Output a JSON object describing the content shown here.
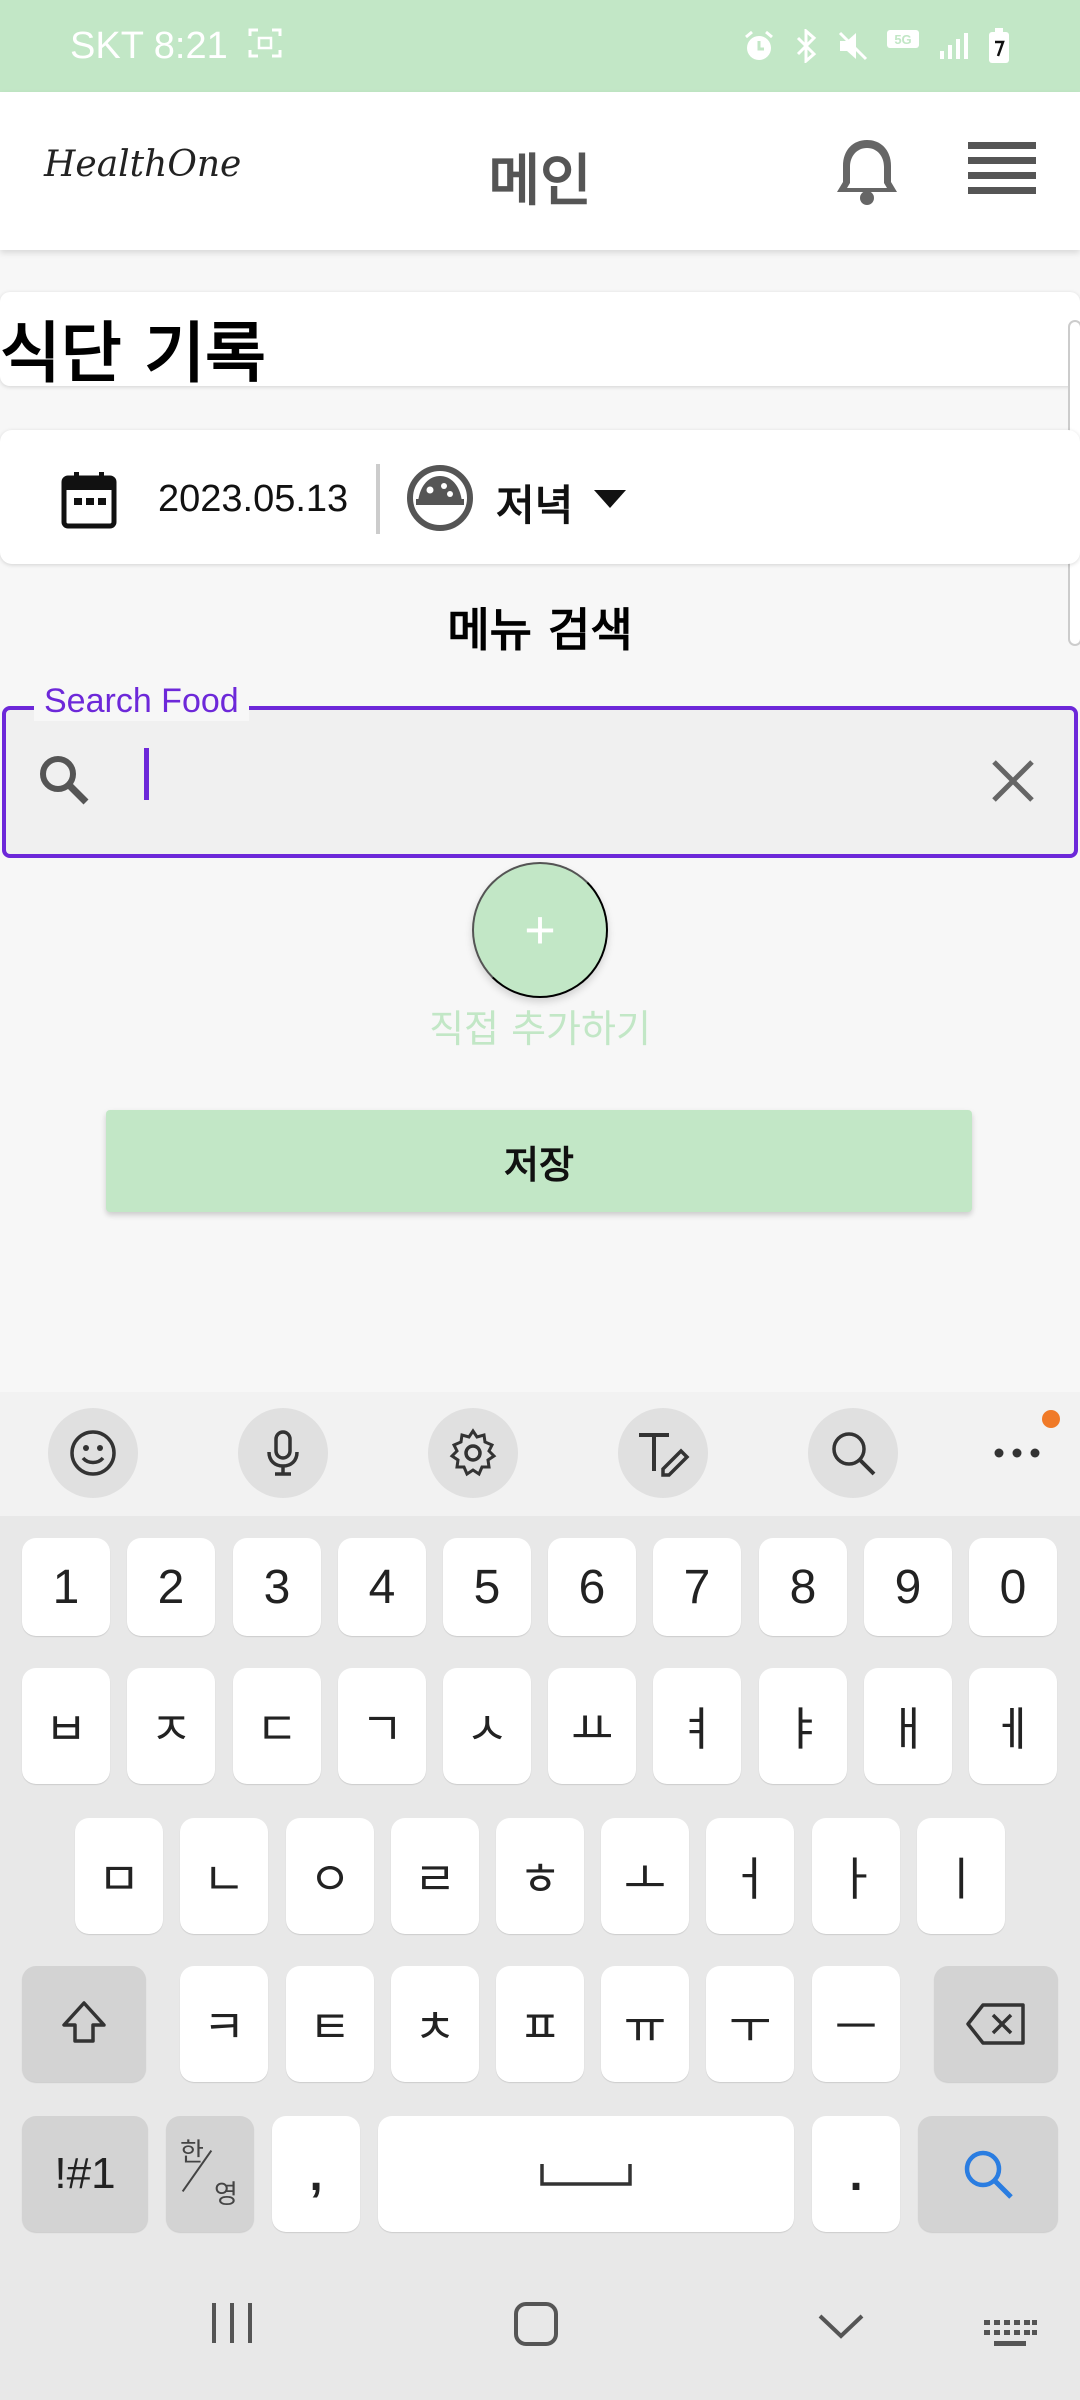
{
  "status_bar": {
    "carrier_time": "SKT 8:21",
    "network": "5G"
  },
  "header": {
    "logo": "HealthOne",
    "title": "메인"
  },
  "page": {
    "title": "식단 기록"
  },
  "date_row": {
    "date": "2023.05.13",
    "meal": "저녁"
  },
  "search": {
    "section_title": "메뉴 검색",
    "label": "Search Food",
    "value": ""
  },
  "add_manual": {
    "icon": "+",
    "label": "직접 추가하기"
  },
  "save_label": "저장",
  "keyboard": {
    "row1": [
      "1",
      "2",
      "3",
      "4",
      "5",
      "6",
      "7",
      "8",
      "9",
      "0"
    ],
    "row2": [
      "ㅂ",
      "ㅈ",
      "ㄷ",
      "ㄱ",
      "ㅅ",
      "ㅛ",
      "ㅕ",
      "ㅑ",
      "ㅐ",
      "ㅔ"
    ],
    "row3": [
      "ㅁ",
      "ㄴ",
      "ㅇ",
      "ㄹ",
      "ㅎ",
      "ㅗ",
      "ㅓ",
      "ㅏ",
      "ㅣ"
    ],
    "row4": [
      "ㅋ",
      "ㅌ",
      "ㅊ",
      "ㅍ",
      "ㅠ",
      "ㅜ",
      "ㅡ"
    ],
    "symbols_label": "!#1",
    "lang_top": "한",
    "lang_bottom": "영",
    "comma": ",",
    "period": "."
  },
  "colors": {
    "accent_green": "#c2e7c6",
    "focus_purple": "#6d28d9",
    "notification_dot": "#f07a28"
  }
}
